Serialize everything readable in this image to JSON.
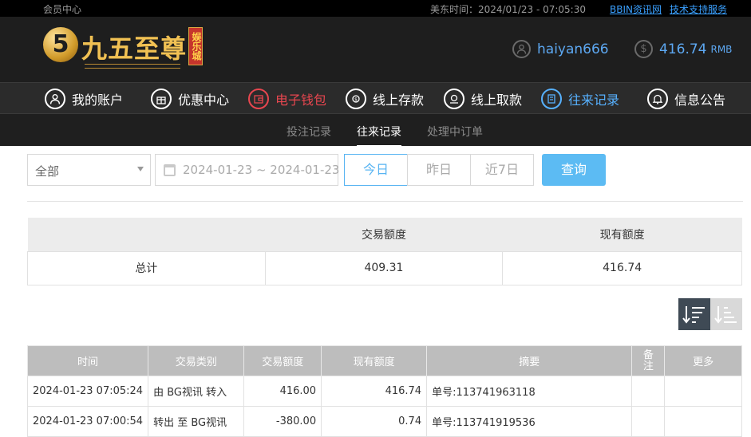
{
  "topbar": {
    "member_center": "会员中心",
    "time_label": "美东时间：2024/01/23 - 07:05:30",
    "bbin_link": "BBIN资讯网",
    "support_link": "技术支持服务"
  },
  "logo": {
    "mark": "5",
    "name": "九五至尊",
    "sub": "娱乐城"
  },
  "user": {
    "username": "haiyan666",
    "balance": "416.74",
    "currency": "RMB"
  },
  "nav": {
    "items": [
      {
        "label": "我的账户",
        "icon": "user-icon"
      },
      {
        "label": "优惠中心",
        "icon": "gift-icon"
      },
      {
        "label": "电子钱包",
        "icon": "wallet-icon"
      },
      {
        "label": "线上存款",
        "icon": "deposit-icon"
      },
      {
        "label": "线上取款",
        "icon": "withdraw-icon"
      },
      {
        "label": "往来记录",
        "icon": "records-icon"
      },
      {
        "label": "信息公告",
        "icon": "bell-icon"
      }
    ]
  },
  "subtabs": [
    "投注记录",
    "往来记录",
    "处理中订单"
  ],
  "filters": {
    "category": "全部",
    "date_range": "2024-01-23 ~ 2024-01-23",
    "today": "今日",
    "yesterday": "昨日",
    "last7": "近7日",
    "query": "查询"
  },
  "summary": {
    "headers": [
      "",
      "交易额度",
      "现有额度"
    ],
    "row": [
      "总计",
      "409.31",
      "416.74"
    ]
  },
  "records": {
    "headers": [
      "时间",
      "交易类别",
      "交易额度",
      "现有额度",
      "摘要",
      "备注",
      "更多"
    ],
    "rows": [
      [
        "2024-01-23 07:05:24",
        "由 BG视讯 转入",
        "416.00",
        "416.74",
        "单号:113741963118",
        "",
        ""
      ],
      [
        "2024-01-23 07:00:54",
        "转出 至 BG视讯",
        "-380.00",
        "0.74",
        "单号:113741919536",
        "",
        ""
      ]
    ]
  },
  "colors": {
    "accent_blue": "#57b1ff",
    "accent_red": "#e8464f",
    "gold": "#f1c153"
  }
}
